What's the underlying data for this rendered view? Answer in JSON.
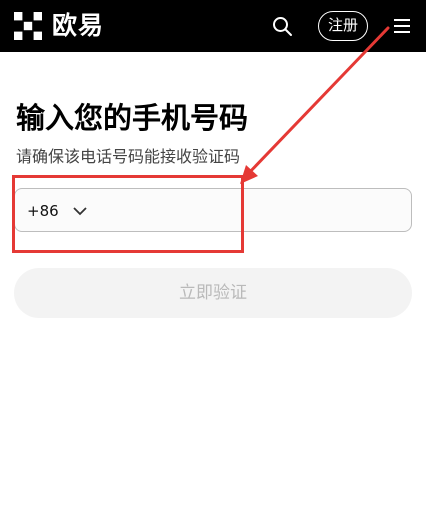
{
  "header": {
    "brand_name": "欧易",
    "logo_icon": "okx-logo-icon",
    "search_icon": "search-icon",
    "register_label": "注册",
    "menu_icon": "hamburger-menu-icon",
    "background_color": "#000000"
  },
  "main": {
    "title": "输入您的手机号码",
    "subtitle": "请确保该电话号码能接收验证码",
    "phone": {
      "country_code": "+86",
      "value": "",
      "placeholder": ""
    },
    "verify_button_label": "立即验证"
  },
  "annotation": {
    "color": "#e53935"
  }
}
